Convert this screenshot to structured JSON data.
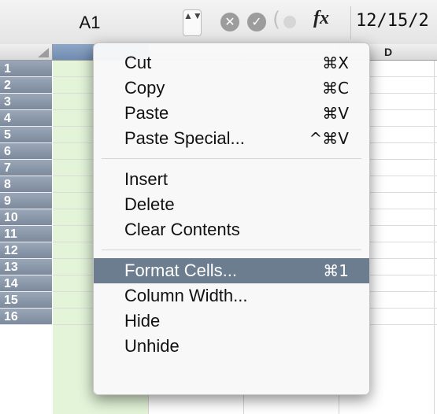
{
  "formula_bar": {
    "cell_reference": "A1",
    "stepper": "▲▼",
    "cancel_glyph": "✕",
    "accept_glyph": "✓",
    "paren_glyph": "(",
    "fx_label": "fx",
    "value": "12/15/2"
  },
  "columns": [
    {
      "label": "",
      "selected": true
    },
    {
      "label": "",
      "selected": false
    },
    {
      "label": "",
      "selected": false
    },
    {
      "label": "D",
      "selected": false
    }
  ],
  "rows": [
    "1",
    "2",
    "3",
    "4",
    "5",
    "6",
    "7",
    "8",
    "9",
    "10",
    "11",
    "12",
    "13",
    "14",
    "15",
    "16"
  ],
  "context_menu": {
    "groups": [
      [
        {
          "label": "Cut",
          "shortcut": "⌘X"
        },
        {
          "label": "Copy",
          "shortcut": "⌘C"
        },
        {
          "label": "Paste",
          "shortcut": "⌘V"
        },
        {
          "label": "Paste Special...",
          "shortcut": "^⌘V"
        }
      ],
      [
        {
          "label": "Insert",
          "shortcut": ""
        },
        {
          "label": "Delete",
          "shortcut": ""
        },
        {
          "label": "Clear Contents",
          "shortcut": ""
        }
      ],
      [
        {
          "label": "Format Cells...",
          "shortcut": "⌘1",
          "highlighted": true
        },
        {
          "label": "Column Width...",
          "shortcut": ""
        },
        {
          "label": "Hide",
          "shortcut": ""
        },
        {
          "label": "Unhide",
          "shortcut": ""
        }
      ]
    ]
  },
  "colors": {
    "selected_column_fill": "#e3f4d8",
    "menu_highlight": "#6b7d8f",
    "row_header": "#8a97aa"
  }
}
